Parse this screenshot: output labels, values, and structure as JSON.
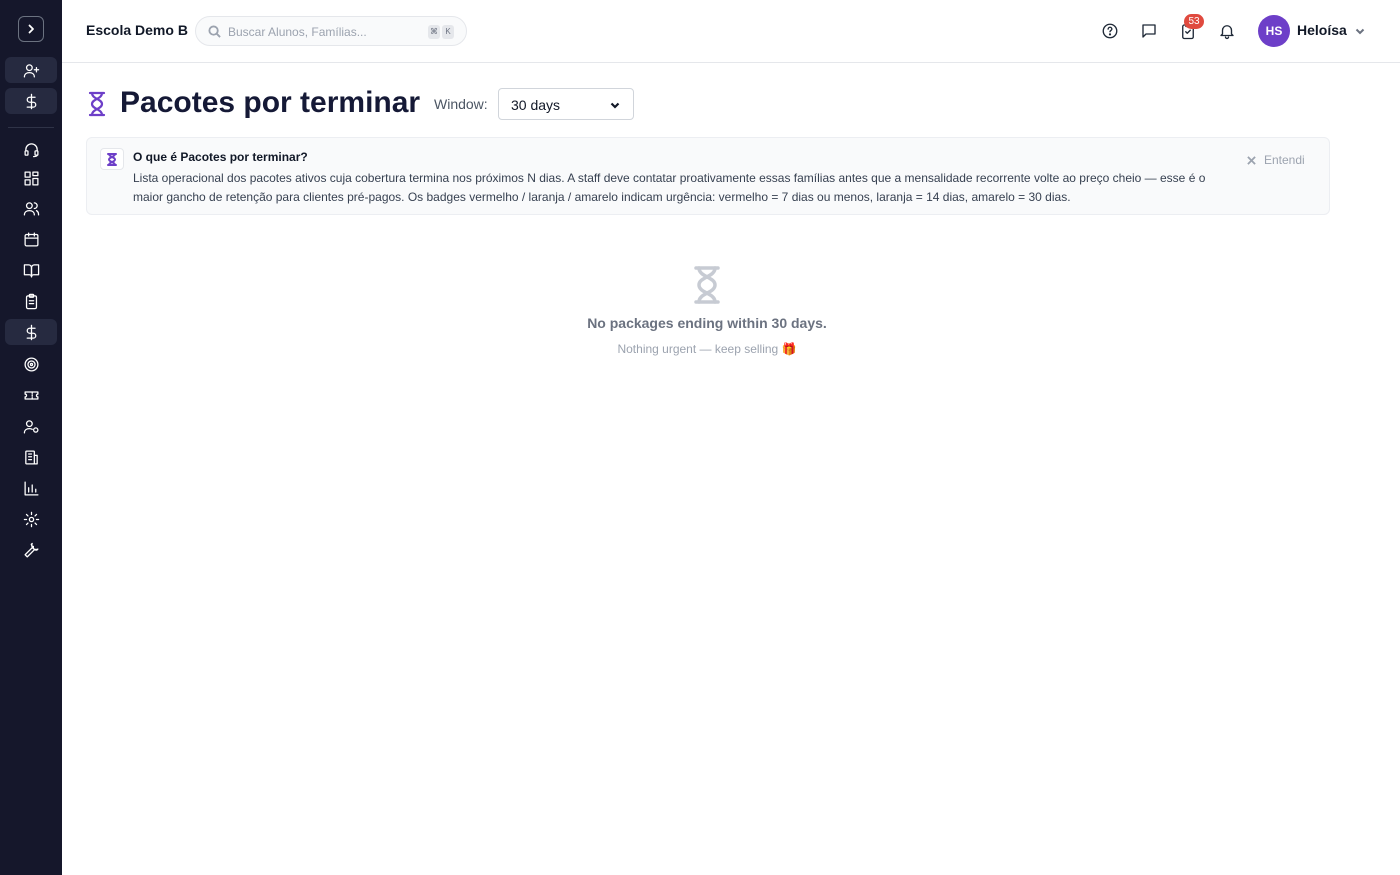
{
  "header": {
    "school_name": "Escola Demo B",
    "search_placeholder": "Buscar Alunos, Famílias...",
    "search_shortcut": [
      "⌘",
      "K"
    ],
    "tasks_badge": "53",
    "user": {
      "initials": "HS",
      "name": "Heloísa"
    }
  },
  "sidebar": {
    "items": [
      {
        "icon": "user-plus-icon"
      },
      {
        "icon": "dollar-icon"
      },
      {
        "icon": "headset-icon"
      },
      {
        "icon": "dashboard-icon"
      },
      {
        "icon": "users-icon"
      },
      {
        "icon": "calendar-icon"
      },
      {
        "icon": "book-open-icon"
      },
      {
        "icon": "clipboard-icon"
      },
      {
        "icon": "dollar-icon",
        "active": true
      },
      {
        "icon": "target-icon"
      },
      {
        "icon": "ticket-icon"
      },
      {
        "icon": "user-cog-icon"
      },
      {
        "icon": "building-icon"
      },
      {
        "icon": "bar-chart-icon"
      },
      {
        "icon": "gear-icon"
      },
      {
        "icon": "wrench-icon"
      }
    ]
  },
  "page": {
    "title": "Pacotes por terminar",
    "window_label": "Window:",
    "window_value": "30 days"
  },
  "info": {
    "title": "O que é Pacotes por terminar?",
    "body": "Lista operacional dos pacotes ativos cuja cobertura termina nos próximos N dias. A staff deve contatar proativamente essas famílias antes que a mensalidade recorrente volte ao preço cheio — esse é o maior gancho de retenção para clientes pré-pagos. Os badges vermelho / laranja / amarelo indicam urgência: vermelho = 7 dias ou menos, laranja = 14 dias, amarelo = 30 dias.",
    "dismiss_label": "Entendi"
  },
  "empty": {
    "title": "No packages ending within 30 days.",
    "subtitle": "Nothing urgent — keep selling 🎁"
  },
  "colors": {
    "sidebar_bg": "#15172b",
    "accent": "#6d3fc8",
    "badge": "#e04a3f"
  }
}
